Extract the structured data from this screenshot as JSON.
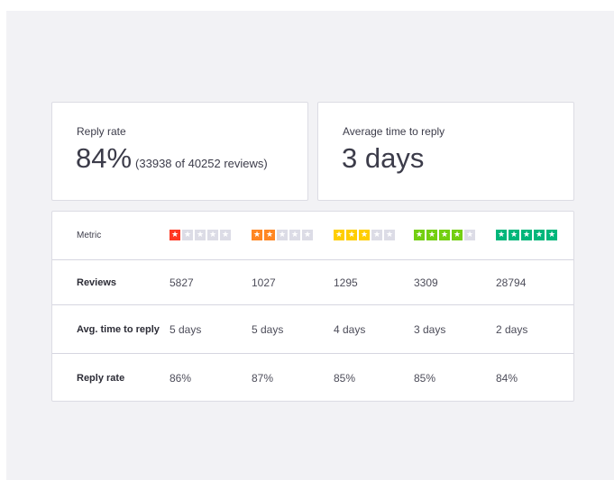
{
  "colors": {
    "star_off": "#dcdce6",
    "rating_1": "#ff3722",
    "rating_2": "#ff8622",
    "rating_3": "#ffce00",
    "rating_4": "#73cf11",
    "rating_5": "#00b67a"
  },
  "icons": {
    "star": "star-icon"
  },
  "kpis": {
    "reply_rate": {
      "label": "Reply rate",
      "value": "84%",
      "detail": "(33938 of 40252 reviews)"
    },
    "avg_time": {
      "label": "Average time to reply",
      "value": "3 days"
    }
  },
  "table": {
    "metric_header": "Metric",
    "ratings": [
      1,
      2,
      3,
      4,
      5
    ],
    "rows": [
      {
        "label": "Reviews",
        "values": [
          "5827",
          "1027",
          "1295",
          "3309",
          "28794"
        ]
      },
      {
        "label": "Avg. time to reply",
        "values": [
          "5 days",
          "5 days",
          "4 days",
          "3 days",
          "2 days"
        ]
      },
      {
        "label": "Reply rate",
        "values": [
          "86%",
          "87%",
          "85%",
          "85%",
          "84%"
        ]
      }
    ]
  }
}
